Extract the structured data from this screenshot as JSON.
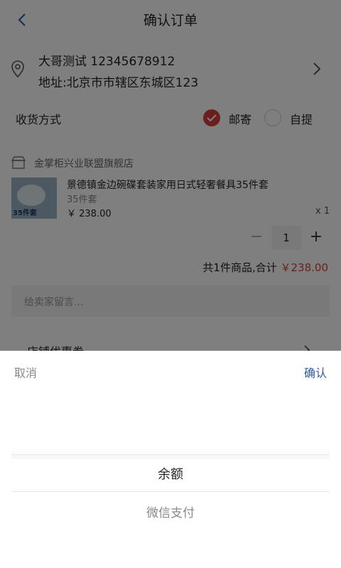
{
  "header": {
    "title": "确认订单",
    "back_icon": "chevron-left-icon"
  },
  "address": {
    "name_phone": "大哥测试 12345678912",
    "line": "地址:北京市市辖区东城区123",
    "icon": "location-pin-icon"
  },
  "delivery": {
    "label": "收货方式",
    "options": [
      {
        "label": "邮寄",
        "selected": true
      },
      {
        "label": "自提",
        "selected": false
      }
    ]
  },
  "shop": {
    "name": "金掌柜兴业联盟旗舰店",
    "product": {
      "title": "景德镇金边碗碟套装家用日式轻奢餐具35件套",
      "spec": "35件套",
      "price": "￥ 238.00",
      "qty_label": "x 1",
      "thumb_text": "35件套"
    },
    "stepper": {
      "minus": "−",
      "value": "1",
      "plus": "+"
    },
    "summary_prefix": "共1件商品,合计 ",
    "summary_amount": "￥238.00"
  },
  "note": {
    "placeholder": "给卖家留言..."
  },
  "coupon": {
    "label": "店铺优惠券"
  },
  "sheet": {
    "cancel": "取消",
    "confirm": "确认",
    "options": [
      "余额",
      "微信支付"
    ]
  },
  "colors": {
    "accent": "#d63c3c",
    "link": "#2f5aa0"
  }
}
